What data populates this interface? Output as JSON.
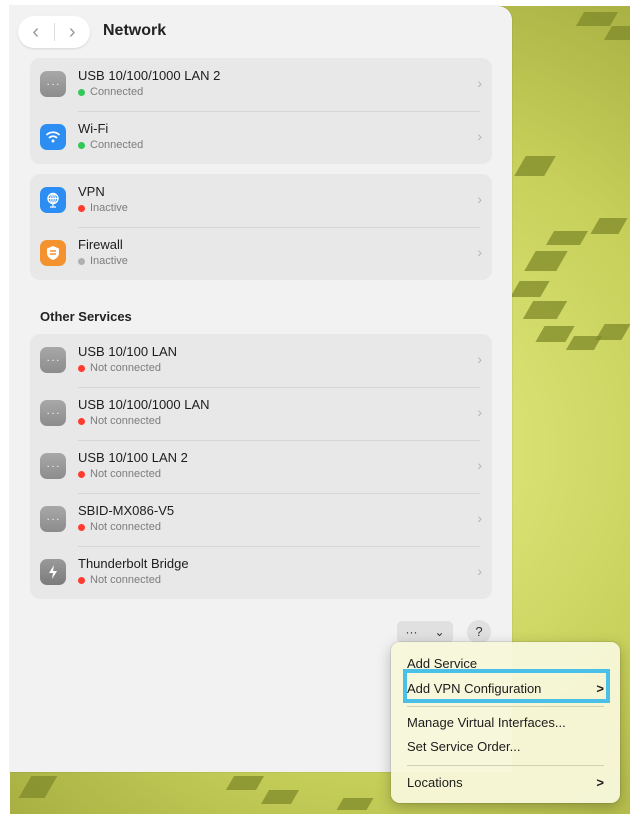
{
  "window": {
    "title": "Network"
  },
  "nav": {
    "back": "‹",
    "forward": "›"
  },
  "primary_services": [
    {
      "name": "USB 10/100/1000 LAN 2",
      "status": "Connected",
      "status_color": "#34c759",
      "icon": "ethernet-icon"
    },
    {
      "name": "Wi-Fi",
      "status": "Connected",
      "status_color": "#34c759",
      "icon": "wifi-icon"
    }
  ],
  "secondary_services": [
    {
      "name": "VPN",
      "status": "Inactive",
      "status_color": "#ff3b30",
      "icon": "vpn-icon"
    },
    {
      "name": "Firewall",
      "status": "Inactive",
      "status_color": "#b0b0b0",
      "icon": "firewall-icon"
    }
  ],
  "other_services_title": "Other Services",
  "other_services": [
    {
      "name": "USB 10/100 LAN",
      "status": "Not connected",
      "status_color": "#ff3b30",
      "icon": "ethernet-icon"
    },
    {
      "name": "USB 10/100/1000 LAN",
      "status": "Not connected",
      "status_color": "#ff3b30",
      "icon": "ethernet-icon"
    },
    {
      "name": "USB 10/100 LAN 2",
      "status": "Not connected",
      "status_color": "#ff3b30",
      "icon": "ethernet-icon"
    },
    {
      "name": "SBID-MX086-V5",
      "status": "Not connected",
      "status_color": "#ff3b30",
      "icon": "ethernet-icon"
    },
    {
      "name": "Thunderbolt Bridge",
      "status": "Not connected",
      "status_color": "#ff3b30",
      "icon": "thunderbolt-icon"
    }
  ],
  "bottom": {
    "actions_label": "···",
    "actions_chevron": "⌄",
    "help_label": "?"
  },
  "menu": {
    "items": [
      {
        "label": "Add Service"
      },
      {
        "label": "Add VPN Configuration",
        "arrow": ">"
      },
      {
        "label": "Manage Virtual Interfaces..."
      },
      {
        "label": "Set Service Order..."
      },
      {
        "label": "Locations",
        "arrow": ">"
      }
    ]
  },
  "colors": {
    "accent_highlight": "#4ac0e8"
  }
}
